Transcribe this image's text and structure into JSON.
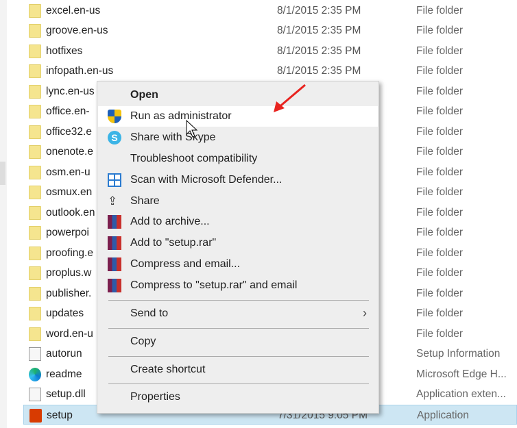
{
  "files": [
    {
      "name": "excel.en-us",
      "date": "8/1/2015 2:35 PM",
      "type": "File folder",
      "icon": "folder-icon"
    },
    {
      "name": "groove.en-us",
      "date": "8/1/2015 2:35 PM",
      "type": "File folder",
      "icon": "folder-icon"
    },
    {
      "name": "hotfixes",
      "date": "8/1/2015 2:35 PM",
      "type": "File folder",
      "icon": "folder-icon"
    },
    {
      "name": "infopath.en-us",
      "date": "8/1/2015 2:35 PM",
      "type": "File folder",
      "icon": "folder-icon"
    },
    {
      "name": "lync.en-us",
      "type": "File folder",
      "icon": "folder-icon"
    },
    {
      "name": "office.en-",
      "type": "File folder",
      "icon": "folder-icon"
    },
    {
      "name": "office32.e",
      "type": "File folder",
      "icon": "folder-icon"
    },
    {
      "name": "onenote.e",
      "type": "File folder",
      "icon": "folder-icon"
    },
    {
      "name": "osm.en-u",
      "type": "File folder",
      "icon": "folder-icon"
    },
    {
      "name": "osmux.en",
      "type": "File folder",
      "icon": "folder-icon"
    },
    {
      "name": "outlook.en",
      "type": "File folder",
      "icon": "folder-icon"
    },
    {
      "name": "powerpoi",
      "type": "File folder",
      "icon": "folder-icon"
    },
    {
      "name": "proofing.e",
      "type": "File folder",
      "icon": "folder-icon"
    },
    {
      "name": "proplus.w",
      "type": "File folder",
      "icon": "folder-icon"
    },
    {
      "name": "publisher.",
      "type": "File folder",
      "icon": "folder-icon"
    },
    {
      "name": "updates",
      "type": "File folder",
      "icon": "folder-icon"
    },
    {
      "name": "word.en-u",
      "type": "File folder",
      "icon": "folder-icon"
    },
    {
      "name": "autorun",
      "type": "Setup Information",
      "icon": "settings-file-icon"
    },
    {
      "name": "readme",
      "type": "Microsoft Edge H...",
      "icon": "edge-icon"
    },
    {
      "name": "setup.dll",
      "type": "Application exten...",
      "icon": "dll-file-icon"
    },
    {
      "name": "setup",
      "date": "7/31/2015 9:05 PM",
      "type": "Application",
      "icon": "office-setup-icon",
      "selected": true
    }
  ],
  "menu": {
    "items": [
      {
        "label": "Open",
        "bold": true
      },
      {
        "label": "Run as administrator",
        "icon": "uac-shield-icon",
        "highlighted": true
      },
      {
        "label": "Share with Skype",
        "icon": "skype-icon"
      },
      {
        "label": "Troubleshoot compatibility"
      },
      {
        "label": "Scan with Microsoft Defender...",
        "icon": "defender-icon"
      },
      {
        "label": "Share",
        "icon": "share-icon"
      },
      {
        "label": "Add to archive...",
        "icon": "winrar-icon"
      },
      {
        "label": "Add to \"setup.rar\"",
        "icon": "winrar-icon"
      },
      {
        "label": "Compress and email...",
        "icon": "winrar-icon"
      },
      {
        "label": "Compress to \"setup.rar\" and email",
        "icon": "winrar-icon"
      },
      {
        "label": "Send to",
        "submenu": true
      },
      {
        "label": "Copy"
      },
      {
        "label": "Create shortcut"
      },
      {
        "label": "Properties"
      }
    ]
  },
  "colors": {
    "arrow": "#e8231f",
    "selection": "#cde6f3",
    "menu_bg": "#eeeeee"
  }
}
